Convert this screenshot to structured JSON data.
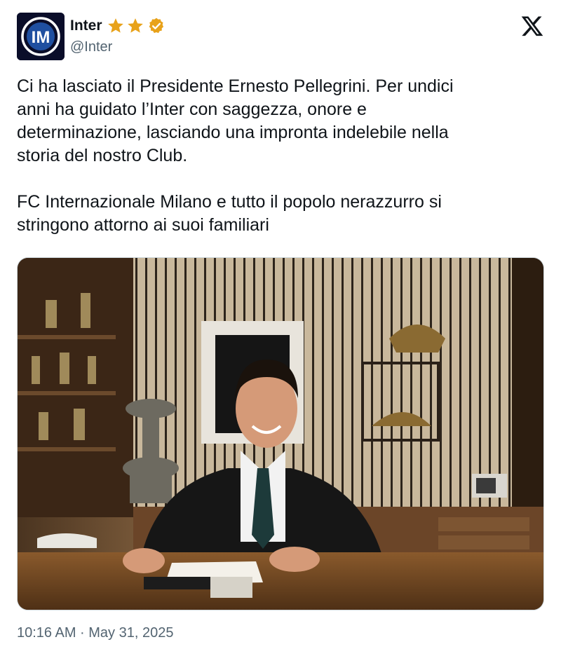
{
  "author": {
    "display_name": "Inter",
    "handle": "@Inter",
    "avatar_icon": "inter-logo-icon",
    "badges": [
      "star-icon",
      "star-icon",
      "verified-badge-icon"
    ],
    "avatar_color": "#0a0d29",
    "badge_gold": "#e8a21a"
  },
  "platform_icon": "x-logo-icon",
  "tweet": {
    "text": "Ci ha lasciato il Presidente Ernesto Pellegrini. Per undici\nanni ha guidato l’Inter con saggezza, onore e\ndeterminazione, lasciando una impronta indelebile nella\nstoria del nostro Club.\n\nFC Internazionale Milano e tutto il popolo nerazzurro si\nstringono attorno ai suoi familiari"
  },
  "media": {
    "kind": "photo",
    "icon": "photo-of-man-at-desk"
  },
  "meta": {
    "timestamp": "10:16 AM · May 31, 2025"
  }
}
